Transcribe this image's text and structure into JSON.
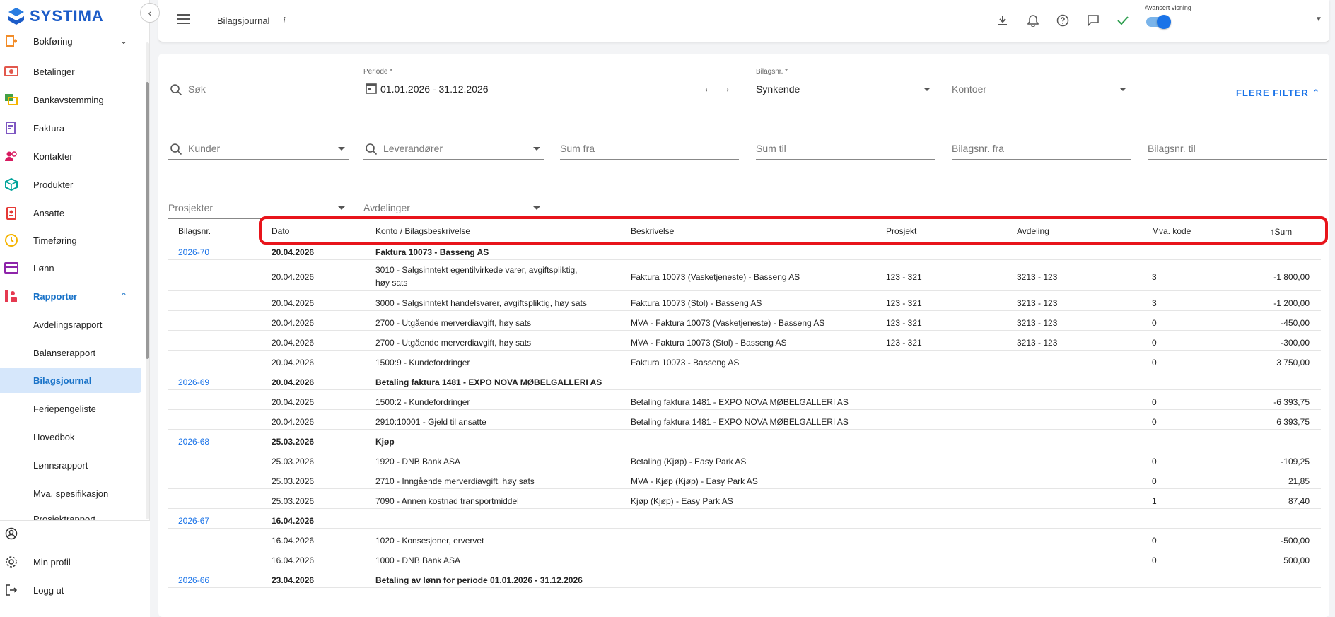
{
  "app": {
    "brand": "SYSTIMA",
    "brand_color": "#1c5cc8"
  },
  "sidebar": {
    "items": [
      {
        "label": "Bokføring",
        "icon": "ledger-icon",
        "color": "#f28c28"
      },
      {
        "label": "Betalinger",
        "icon": "payment-icon",
        "color": "#e2574c"
      },
      {
        "label": "Bankavstemming",
        "icon": "bank-reconcile-icon",
        "color": "#43a047"
      },
      {
        "label": "Faktura",
        "icon": "invoice-icon",
        "color": "#7e57c2"
      },
      {
        "label": "Kontakter",
        "icon": "contacts-icon",
        "color": "#d81b60"
      },
      {
        "label": "Produkter",
        "icon": "product-box-icon",
        "color": "#00a39a"
      },
      {
        "label": "Ansatte",
        "icon": "employee-badge-icon",
        "color": "#e53935"
      },
      {
        "label": "Timeføring",
        "icon": "clock-icon",
        "color": "#f5b400"
      },
      {
        "label": "Lønn",
        "icon": "salary-card-icon",
        "color": "#8e24aa"
      },
      {
        "label": "Rapporter",
        "icon": "reports-icon",
        "color": "#e53950"
      }
    ],
    "report_items": [
      "Avdelingsrapport",
      "Balanserapport",
      "Bilagsjournal",
      "Feriepengeliste",
      "Hovedbok",
      "Lønnsrapport",
      "Mva. spesifikasjon",
      "Prosjektrapport"
    ],
    "active_item": "Bilagsjournal",
    "bottom": {
      "profile": "Min profil",
      "logout": "Logg ut"
    }
  },
  "topbar": {
    "title": "Bilagsjournal",
    "info": "i",
    "toggle_label": "Avansert visning",
    "toggle_on": true,
    "accent": "#1a73e8"
  },
  "filters": {
    "search_placeholder": "Søk",
    "period_label": "Periode *",
    "period_value": "01.01.2026 - 31.12.2026",
    "bilagsnr_label": "Bilagsnr. *",
    "bilagsnr_value": "Synkende",
    "kontoer": "Kontoer",
    "more_filters": "FLERE FILTER",
    "kunder": "Kunder",
    "leverandorer": "Leverandører",
    "sum_fra": "Sum fra",
    "sum_til": "Sum til",
    "bilagsnr_fra": "Bilagsnr. fra",
    "bilagsnr_til": "Bilagsnr. til",
    "prosjekter": "Prosjekter",
    "avdelinger": "Avdelinger"
  },
  "table": {
    "headers": {
      "bilagsnr": "Bilagsnr.",
      "dato": "Dato",
      "konto": "Konto / Bilagsbeskrivelse",
      "beskrivelse": "Beskrivelse",
      "prosjekt": "Prosjekt",
      "avdeling": "Avdeling",
      "mva": "Mva. kode",
      "sum": "Sum"
    },
    "highlight_color": "#e8141b",
    "rows": [
      {
        "type": "group",
        "nr": "2026-70",
        "dato": "20.04.2026",
        "konto": "Faktura 10073 - Basseng AS"
      },
      {
        "type": "line",
        "dato": "20.04.2026",
        "konto": "3010 - Salgsinntekt egentilvirkede varer, avgiftspliktig,",
        "konto2": "høy sats",
        "beskrivelse": "Faktura 10073 (Vasketjeneste) - Basseng AS",
        "prosjekt": "123 - 321",
        "avdeling": "3213 - 123",
        "mva": "3",
        "sum": "-1 800,00"
      },
      {
        "type": "line",
        "dato": "20.04.2026",
        "konto": "3000 - Salgsinntekt handelsvarer, avgiftspliktig, høy sats",
        "beskrivelse": "Faktura 10073 (Stol) - Basseng AS",
        "prosjekt": "123 - 321",
        "avdeling": "3213 - 123",
        "mva": "3",
        "sum": "-1 200,00"
      },
      {
        "type": "line",
        "dato": "20.04.2026",
        "konto": "2700 - Utgående merverdiavgift, høy sats",
        "beskrivelse": "MVA - Faktura 10073 (Vasketjeneste) - Basseng AS",
        "prosjekt": "123 - 321",
        "avdeling": "3213 - 123",
        "mva": "0",
        "sum": "-450,00"
      },
      {
        "type": "line",
        "dato": "20.04.2026",
        "konto": "2700 - Utgående merverdiavgift, høy sats",
        "beskrivelse": "MVA - Faktura 10073 (Stol) - Basseng AS",
        "prosjekt": "123 - 321",
        "avdeling": "3213 - 123",
        "mva": "0",
        "sum": "-300,00"
      },
      {
        "type": "line",
        "dato": "20.04.2026",
        "konto": "1500:9 - Kundefordringer",
        "beskrivelse": "Faktura 10073 - Basseng AS",
        "prosjekt": "",
        "avdeling": "",
        "mva": "0",
        "sum": "3 750,00"
      },
      {
        "type": "group",
        "nr": "2026-69",
        "dato": "20.04.2026",
        "konto": "Betaling faktura 1481 - EXPO NOVA MØBELGALLERI AS"
      },
      {
        "type": "line",
        "dato": "20.04.2026",
        "konto": "1500:2 - Kundefordringer",
        "beskrivelse": "Betaling faktura 1481 - EXPO NOVA MØBELGALLERI AS",
        "prosjekt": "",
        "avdeling": "",
        "mva": "0",
        "sum": "-6 393,75"
      },
      {
        "type": "line",
        "dato": "20.04.2026",
        "konto": "2910:10001 - Gjeld til ansatte",
        "beskrivelse": "Betaling faktura 1481 - EXPO NOVA MØBELGALLERI AS",
        "prosjekt": "",
        "avdeling": "",
        "mva": "0",
        "sum": "6 393,75"
      },
      {
        "type": "group",
        "nr": "2026-68",
        "dato": "25.03.2026",
        "konto": "Kjøp"
      },
      {
        "type": "line",
        "dato": "25.03.2026",
        "konto": "1920 - DNB Bank ASA",
        "beskrivelse": "Betaling (Kjøp) - Easy Park AS",
        "prosjekt": "",
        "avdeling": "",
        "mva": "0",
        "sum": "-109,25"
      },
      {
        "type": "line",
        "dato": "25.03.2026",
        "konto": "2710 - Inngående merverdiavgift, høy sats",
        "beskrivelse": "MVA - Kjøp (Kjøp) - Easy Park AS",
        "prosjekt": "",
        "avdeling": "",
        "mva": "0",
        "sum": "21,85"
      },
      {
        "type": "line",
        "dato": "25.03.2026",
        "konto": "7090 - Annen kostnad transportmiddel",
        "beskrivelse": "Kjøp (Kjøp) - Easy Park AS",
        "prosjekt": "",
        "avdeling": "",
        "mva": "1",
        "sum": "87,40"
      },
      {
        "type": "group",
        "nr": "2026-67",
        "dato": "16.04.2026",
        "konto": ""
      },
      {
        "type": "line",
        "dato": "16.04.2026",
        "konto": "1020 - Konsesjoner, ervervet",
        "beskrivelse": "",
        "prosjekt": "",
        "avdeling": "",
        "mva": "0",
        "sum": "-500,00"
      },
      {
        "type": "line",
        "dato": "16.04.2026",
        "konto": "1000 - DNB Bank ASA",
        "beskrivelse": "",
        "prosjekt": "",
        "avdeling": "",
        "mva": "0",
        "sum": "500,00"
      },
      {
        "type": "group",
        "nr": "2026-66",
        "dato": "23.04.2026",
        "konto": "Betaling av lønn for periode 01.01.2026 - 31.12.2026"
      }
    ]
  }
}
